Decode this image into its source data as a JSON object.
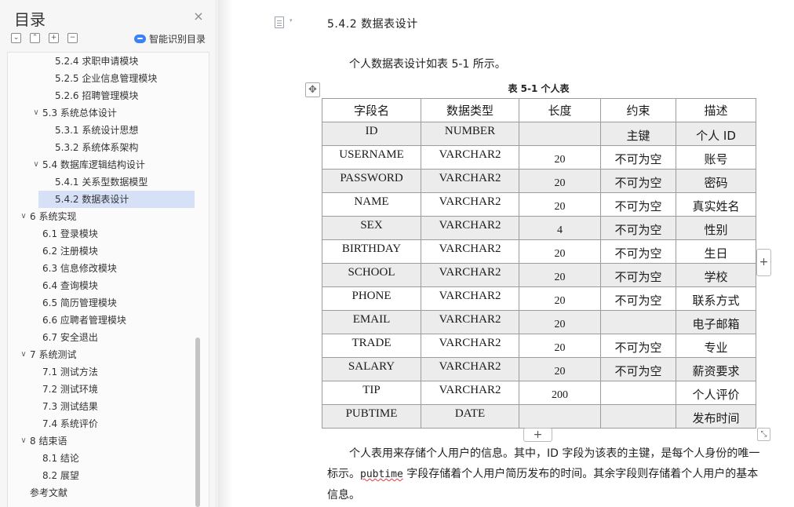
{
  "sidebar": {
    "title": "目录",
    "close_icon": "×",
    "smart_toc_label": "智能识别目录",
    "toolbar_glyphs": [
      "⌄",
      "⌃",
      "+",
      "−"
    ],
    "items": [
      {
        "label": "5.2.4  求职申请模块"
      },
      {
        "label": "5.2.5  企业信息管理模块"
      },
      {
        "label": "5.2.6  招聘管理模块"
      },
      {
        "label": "5.3 系统总体设计",
        "chev": "∨"
      },
      {
        "label": "5.3.1  系统设计思想"
      },
      {
        "label": "5.3.2  系统体系架构"
      },
      {
        "label": "5.4  数据库逻辑结构设计",
        "chev": "∨"
      },
      {
        "label": "5.4.1  关系型数据模型"
      },
      {
        "label": "5.4.2  数据表设计",
        "active": true
      },
      {
        "label": "6    系统实现",
        "chev": "∨"
      },
      {
        "label": "6.1  登录模块"
      },
      {
        "label": "6.2  注册模块"
      },
      {
        "label": "6.3  信息修改模块"
      },
      {
        "label": "6.4  查询模块"
      },
      {
        "label": "6.5  简历管理模块"
      },
      {
        "label": "6.6  应聘者管理模块"
      },
      {
        "label": "6.7  安全退出"
      },
      {
        "label": "7    系统测试",
        "chev": "∨"
      },
      {
        "label": "7.1  测试方法"
      },
      {
        "label": "7.2 测试环境"
      },
      {
        "label": "7.3 测试结果"
      },
      {
        "label": "7.4 系统评价"
      },
      {
        "label": "8    结束语",
        "chev": "∨"
      },
      {
        "label": "8.1 结论"
      },
      {
        "label": "8.2 展望"
      },
      {
        "label": "参考文献"
      }
    ]
  },
  "document": {
    "heading": "5.4.2  数据表设计",
    "intro": "个人数据表设计如表 5-1 所示。",
    "caption": "表 5-1  个人表",
    "table": {
      "headers": [
        "字段名",
        "数据类型",
        "长度",
        "约束",
        "描述"
      ],
      "rows": [
        [
          "ID",
          "NUMBER",
          "",
          "主键",
          "个人 ID"
        ],
        [
          "USERNAME",
          "VARCHAR2",
          "20",
          "不可为空",
          "账号"
        ],
        [
          "PASSWORD",
          "VARCHAR2",
          "20",
          "不可为空",
          "密码"
        ],
        [
          "NAME",
          "VARCHAR2",
          "20",
          "不可为空",
          "真实姓名"
        ],
        [
          "SEX",
          "VARCHAR2",
          "4",
          "不可为空",
          "性别"
        ],
        [
          "BIRTHDAY",
          "VARCHAR2",
          "20",
          "不可为空",
          "生日"
        ],
        [
          "SCHOOL",
          "VARCHAR2",
          "20",
          "不可为空",
          "学校"
        ],
        [
          "PHONE",
          "VARCHAR2",
          "20",
          "不可为空",
          "联系方式"
        ],
        [
          "EMAIL",
          "VARCHAR2",
          "20",
          "",
          "电子邮箱"
        ],
        [
          "TRADE",
          "VARCHAR2",
          "20",
          "不可为空",
          "专业"
        ],
        [
          "SALARY",
          "VARCHAR2",
          "20",
          "不可为空",
          "薪资要求"
        ],
        [
          "TIP",
          "VARCHAR2",
          "200",
          "",
          "个人评价"
        ],
        [
          "PUBTIME",
          "DATE",
          "",
          "",
          "发布时间"
        ]
      ]
    },
    "paragraph": {
      "part1": "个人表用来存储个人用户的信息。其中，ID 字段为该表的主键，是每个人身份的唯一标示。",
      "code": "pubtime",
      "part2": " 字段存储着个人用户简历发布的时间。其余字段则存储着个人用户的基本信息。"
    },
    "controls": {
      "add_row": "+",
      "add_col": "+",
      "move_glyph": "✥",
      "resize_glyph": "⤡",
      "page_icon": "document-icon"
    }
  }
}
